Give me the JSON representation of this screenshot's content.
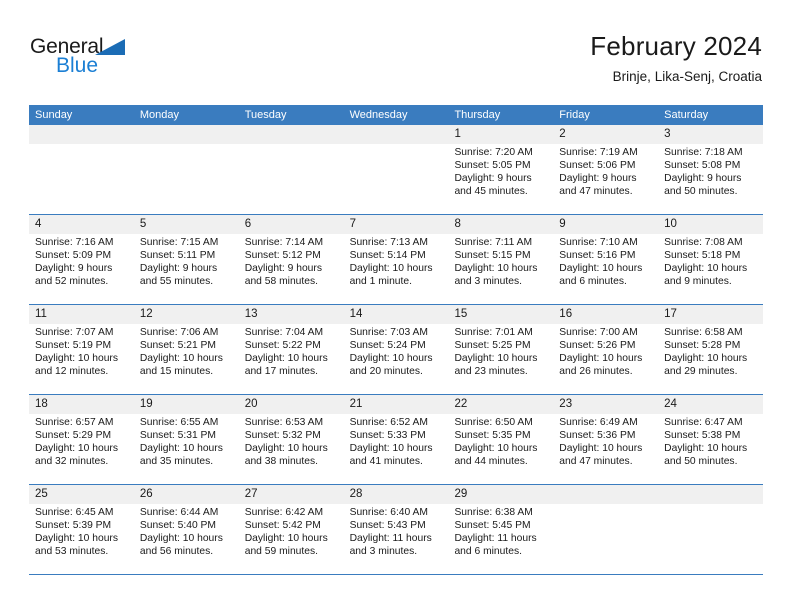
{
  "brand": {
    "name_top": "General",
    "name_bottom": "Blue",
    "mark": "triangle-logo",
    "accent_color": "#1b7fd4"
  },
  "header": {
    "title": "February 2024",
    "subtitle": "Brinje, Lika-Senj, Croatia"
  },
  "theme": {
    "header_blue": "#3a7cbf",
    "daynum_gray": "#f0f0f0",
    "text": "#1a1a1a"
  },
  "calendar": {
    "weekdays": [
      "Sunday",
      "Monday",
      "Tuesday",
      "Wednesday",
      "Thursday",
      "Friday",
      "Saturday"
    ],
    "weeks": [
      [
        {
          "day": "",
          "lines": [
            "",
            "",
            "",
            ""
          ]
        },
        {
          "day": "",
          "lines": [
            "",
            "",
            "",
            ""
          ]
        },
        {
          "day": "",
          "lines": [
            "",
            "",
            "",
            ""
          ]
        },
        {
          "day": "",
          "lines": [
            "",
            "",
            "",
            ""
          ]
        },
        {
          "day": "1",
          "lines": [
            "Sunrise: 7:20 AM",
            "Sunset: 5:05 PM",
            "Daylight: 9 hours",
            "and 45 minutes."
          ]
        },
        {
          "day": "2",
          "lines": [
            "Sunrise: 7:19 AM",
            "Sunset: 5:06 PM",
            "Daylight: 9 hours",
            "and 47 minutes."
          ]
        },
        {
          "day": "3",
          "lines": [
            "Sunrise: 7:18 AM",
            "Sunset: 5:08 PM",
            "Daylight: 9 hours",
            "and 50 minutes."
          ]
        }
      ],
      [
        {
          "day": "4",
          "lines": [
            "Sunrise: 7:16 AM",
            "Sunset: 5:09 PM",
            "Daylight: 9 hours",
            "and 52 minutes."
          ]
        },
        {
          "day": "5",
          "lines": [
            "Sunrise: 7:15 AM",
            "Sunset: 5:11 PM",
            "Daylight: 9 hours",
            "and 55 minutes."
          ]
        },
        {
          "day": "6",
          "lines": [
            "Sunrise: 7:14 AM",
            "Sunset: 5:12 PM",
            "Daylight: 9 hours",
            "and 58 minutes."
          ]
        },
        {
          "day": "7",
          "lines": [
            "Sunrise: 7:13 AM",
            "Sunset: 5:14 PM",
            "Daylight: 10 hours",
            "and 1 minute."
          ]
        },
        {
          "day": "8",
          "lines": [
            "Sunrise: 7:11 AM",
            "Sunset: 5:15 PM",
            "Daylight: 10 hours",
            "and 3 minutes."
          ]
        },
        {
          "day": "9",
          "lines": [
            "Sunrise: 7:10 AM",
            "Sunset: 5:16 PM",
            "Daylight: 10 hours",
            "and 6 minutes."
          ]
        },
        {
          "day": "10",
          "lines": [
            "Sunrise: 7:08 AM",
            "Sunset: 5:18 PM",
            "Daylight: 10 hours",
            "and 9 minutes."
          ]
        }
      ],
      [
        {
          "day": "11",
          "lines": [
            "Sunrise: 7:07 AM",
            "Sunset: 5:19 PM",
            "Daylight: 10 hours",
            "and 12 minutes."
          ]
        },
        {
          "day": "12",
          "lines": [
            "Sunrise: 7:06 AM",
            "Sunset: 5:21 PM",
            "Daylight: 10 hours",
            "and 15 minutes."
          ]
        },
        {
          "day": "13",
          "lines": [
            "Sunrise: 7:04 AM",
            "Sunset: 5:22 PM",
            "Daylight: 10 hours",
            "and 17 minutes."
          ]
        },
        {
          "day": "14",
          "lines": [
            "Sunrise: 7:03 AM",
            "Sunset: 5:24 PM",
            "Daylight: 10 hours",
            "and 20 minutes."
          ]
        },
        {
          "day": "15",
          "lines": [
            "Sunrise: 7:01 AM",
            "Sunset: 5:25 PM",
            "Daylight: 10 hours",
            "and 23 minutes."
          ]
        },
        {
          "day": "16",
          "lines": [
            "Sunrise: 7:00 AM",
            "Sunset: 5:26 PM",
            "Daylight: 10 hours",
            "and 26 minutes."
          ]
        },
        {
          "day": "17",
          "lines": [
            "Sunrise: 6:58 AM",
            "Sunset: 5:28 PM",
            "Daylight: 10 hours",
            "and 29 minutes."
          ]
        }
      ],
      [
        {
          "day": "18",
          "lines": [
            "Sunrise: 6:57 AM",
            "Sunset: 5:29 PM",
            "Daylight: 10 hours",
            "and 32 minutes."
          ]
        },
        {
          "day": "19",
          "lines": [
            "Sunrise: 6:55 AM",
            "Sunset: 5:31 PM",
            "Daylight: 10 hours",
            "and 35 minutes."
          ]
        },
        {
          "day": "20",
          "lines": [
            "Sunrise: 6:53 AM",
            "Sunset: 5:32 PM",
            "Daylight: 10 hours",
            "and 38 minutes."
          ]
        },
        {
          "day": "21",
          "lines": [
            "Sunrise: 6:52 AM",
            "Sunset: 5:33 PM",
            "Daylight: 10 hours",
            "and 41 minutes."
          ]
        },
        {
          "day": "22",
          "lines": [
            "Sunrise: 6:50 AM",
            "Sunset: 5:35 PM",
            "Daylight: 10 hours",
            "and 44 minutes."
          ]
        },
        {
          "day": "23",
          "lines": [
            "Sunrise: 6:49 AM",
            "Sunset: 5:36 PM",
            "Daylight: 10 hours",
            "and 47 minutes."
          ]
        },
        {
          "day": "24",
          "lines": [
            "Sunrise: 6:47 AM",
            "Sunset: 5:38 PM",
            "Daylight: 10 hours",
            "and 50 minutes."
          ]
        }
      ],
      [
        {
          "day": "25",
          "lines": [
            "Sunrise: 6:45 AM",
            "Sunset: 5:39 PM",
            "Daylight: 10 hours",
            "and 53 minutes."
          ]
        },
        {
          "day": "26",
          "lines": [
            "Sunrise: 6:44 AM",
            "Sunset: 5:40 PM",
            "Daylight: 10 hours",
            "and 56 minutes."
          ]
        },
        {
          "day": "27",
          "lines": [
            "Sunrise: 6:42 AM",
            "Sunset: 5:42 PM",
            "Daylight: 10 hours",
            "and 59 minutes."
          ]
        },
        {
          "day": "28",
          "lines": [
            "Sunrise: 6:40 AM",
            "Sunset: 5:43 PM",
            "Daylight: 11 hours",
            "and 3 minutes."
          ]
        },
        {
          "day": "29",
          "lines": [
            "Sunrise: 6:38 AM",
            "Sunset: 5:45 PM",
            "Daylight: 11 hours",
            "and 6 minutes."
          ]
        },
        {
          "day": "",
          "lines": [
            "",
            "",
            "",
            ""
          ]
        },
        {
          "day": "",
          "lines": [
            "",
            "",
            "",
            ""
          ]
        }
      ]
    ]
  }
}
